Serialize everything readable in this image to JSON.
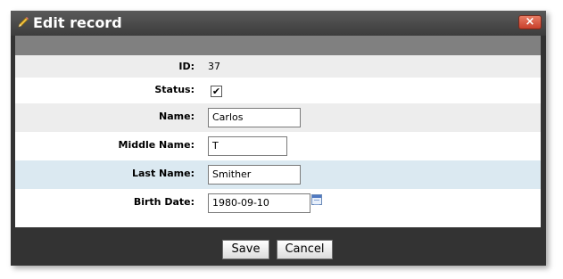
{
  "window": {
    "title": "Edit record",
    "title_icon": "pencil-icon",
    "close_icon": "close-icon",
    "close_glyph": "×"
  },
  "form": {
    "id": {
      "label": "ID:",
      "value": "37"
    },
    "status": {
      "label": "Status:",
      "checked": true,
      "check_glyph": "✔"
    },
    "name": {
      "label": "Name:",
      "value": "Carlos"
    },
    "middle_name": {
      "label": "Middle Name:",
      "value": "T"
    },
    "last_name": {
      "label": "Last Name:",
      "value": "Smither"
    },
    "birth_date": {
      "label": "Birth Date:",
      "value": "1980-09-10",
      "calendar_icon": "calendar-icon"
    }
  },
  "buttons": {
    "save_label": "Save",
    "cancel_label": "Cancel"
  },
  "colors": {
    "frame": "#333333",
    "header_strip": "#808080",
    "row_shade": "#ededed",
    "row_highlight": "#dbe9f1",
    "close_button": "#d0503a"
  }
}
